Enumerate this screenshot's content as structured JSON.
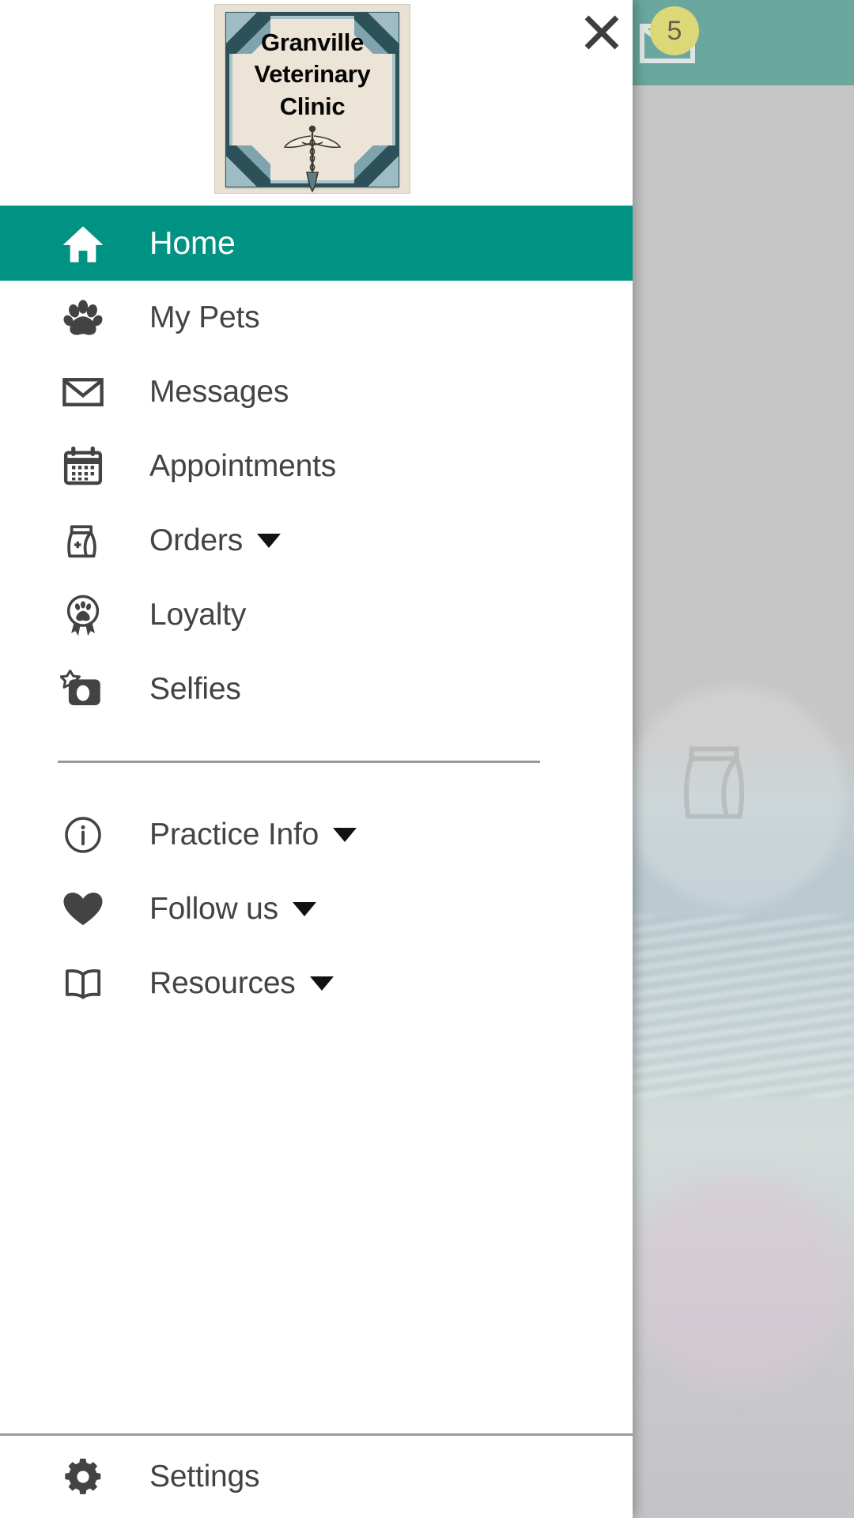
{
  "background": {
    "badge_count": "5",
    "mail_icon": "envelope-icon",
    "header_color": "#6aa79f",
    "badge_color": "#ddd877"
  },
  "drawer": {
    "logo": {
      "line1": "Granville",
      "line2": "Veterinary",
      "line3": "Clinic",
      "symbol": "caduceus-icon",
      "plate_color": "#ece5d7",
      "border_color": "#2d5159"
    },
    "close_label": "close-icon",
    "accent_color": "#009384",
    "text_color": "#434343",
    "primary_items": [
      {
        "label": "Home",
        "icon": "home-icon",
        "active": true,
        "expandable": false
      },
      {
        "label": "My Pets",
        "icon": "paw-icon",
        "active": false,
        "expandable": false
      },
      {
        "label": "Messages",
        "icon": "envelope-icon",
        "active": false,
        "expandable": false
      },
      {
        "label": "Appointments",
        "icon": "calendar-icon",
        "active": false,
        "expandable": false
      },
      {
        "label": "Orders",
        "icon": "food-bag-icon",
        "active": false,
        "expandable": true
      },
      {
        "label": "Loyalty",
        "icon": "award-paw-icon",
        "active": false,
        "expandable": false
      },
      {
        "label": "Selfies",
        "icon": "camera-star-icon",
        "active": false,
        "expandable": false
      }
    ],
    "secondary_items": [
      {
        "label": "Practice Info",
        "icon": "info-circle-icon",
        "active": false,
        "expandable": true
      },
      {
        "label": "Follow us",
        "icon": "heart-icon",
        "active": false,
        "expandable": true
      },
      {
        "label": "Resources",
        "icon": "open-book-icon",
        "active": false,
        "expandable": true
      }
    ],
    "footer_items": [
      {
        "label": "Settings",
        "icon": "gear-icon",
        "active": false,
        "expandable": false
      }
    ]
  }
}
